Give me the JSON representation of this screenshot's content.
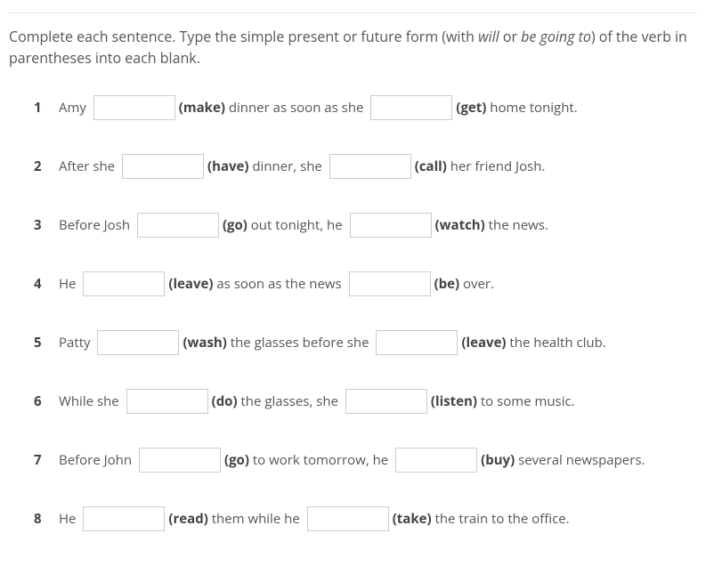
{
  "instructions": {
    "prefix": "Complete each sentence. Type the simple present or future form (with ",
    "italic1": "will",
    "mid": " or ",
    "italic2": "be going to",
    "suffix": ") of the verb in parentheses into each blank."
  },
  "items": [
    {
      "num": "1",
      "parts": [
        "Amy ",
        "(make)",
        " dinner as soon as she ",
        "(get)",
        " home tonight."
      ]
    },
    {
      "num": "2",
      "parts": [
        "After she ",
        "(have)",
        " dinner, she ",
        "(call)",
        " her friend Josh."
      ]
    },
    {
      "num": "3",
      "parts": [
        "Before Josh ",
        "(go)",
        " out tonight, he ",
        "(watch)",
        " the news."
      ]
    },
    {
      "num": "4",
      "parts": [
        "He ",
        "(leave)",
        " as soon as the news ",
        "(be)",
        " over."
      ]
    },
    {
      "num": "5",
      "parts": [
        "Patty ",
        "(wash)",
        " the glasses before she ",
        "(leave)",
        " the health club."
      ]
    },
    {
      "num": "6",
      "parts": [
        "While she ",
        "(do)",
        " the glasses, she ",
        "(listen)",
        " to some music."
      ]
    },
    {
      "num": "7",
      "parts": [
        "Before John ",
        "(go)",
        " to work tomorrow, he ",
        "(buy)",
        " several newspapers."
      ]
    },
    {
      "num": "8",
      "parts": [
        "He ",
        "(read)",
        " them while he ",
        "(take)",
        " the train to the office."
      ]
    }
  ]
}
